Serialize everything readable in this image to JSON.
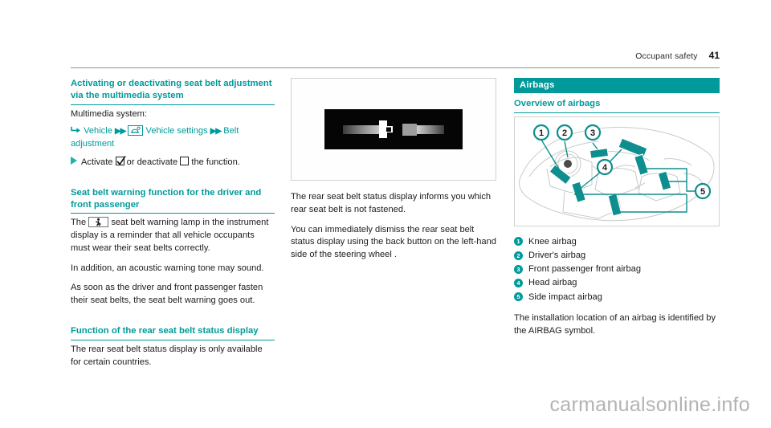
{
  "header": {
    "chapter": "Occupant safety",
    "page_number": "41"
  },
  "left_column": {
    "heading_1": "Activating or deactivating seat belt adjustment via the multimedia system",
    "intro": "Multimedia system:",
    "nav_path": {
      "enter_icon": "enter-arrow-icon",
      "item_1": "Vehicle",
      "separator": "▶▶",
      "settings_icon": "vehicle-settings-icon",
      "item_2": "Vehicle settings",
      "item_3": "Belt adjustment"
    },
    "step": {
      "bullet_icon": "triangle-bullet-icon",
      "text_before": "Activate",
      "checked_icon": "checked-checkbox-icon",
      "text_middle": "or deactivate",
      "unchecked_icon": "unchecked-checkbox-icon",
      "text_after": "the function."
    },
    "heading_2": "Seat belt warning function for the driver and front passenger",
    "para_1_before": "The",
    "para_1_icon": "seat-belt-warning-lamp-icon",
    "para_1_after": "seat belt warning lamp in the instrument display is a reminder that all vehicle occupants must wear their seat belts correctly.",
    "para_2": "In addition, an acoustic warning tone may sound.",
    "para_3": "As soon as the driver and front passenger fasten their seat belts, the seat belt warning goes out.",
    "heading_3": "Function of the rear seat belt status display",
    "para_4": "The rear seat belt status display is only available for certain countries."
  },
  "middle_column": {
    "figure": {
      "name": "rear-seat-belt-status-display-photo",
      "caption_alt": "Instrument display showing unfastened rear seat belt buckle symbol"
    },
    "para_1": "The rear seat belt status display informs you which rear seat belt is not fastened.",
    "para_2": "You can immediately dismiss the rear seat belt status display using the back button on the left-hand side of the steering wheel ."
  },
  "right_column": {
    "band_title": "Airbags",
    "heading": "Overview of airbags",
    "figure": {
      "name": "airbag-overview-diagram",
      "caption_alt": "Cutaway view of vehicle interior with airbag locations highlighted"
    },
    "legend": [
      {
        "number": "1",
        "label": "Knee airbag"
      },
      {
        "number": "2",
        "label": "Driver's airbag"
      },
      {
        "number": "3",
        "label": "Front passenger front airbag"
      },
      {
        "number": "4",
        "label": "Head airbag"
      },
      {
        "number": "5",
        "label": "Side impact airbag"
      }
    ],
    "closing_para": "The installation location of an airbag is identified by the AIRBAG symbol."
  },
  "watermark": "carmanualsonline.info",
  "colors": {
    "teal": "#009a9a",
    "bullet_teal": "#1bb3ad",
    "rule_gray": "#8d9295",
    "watermark_gray": "#b3b3b3"
  }
}
